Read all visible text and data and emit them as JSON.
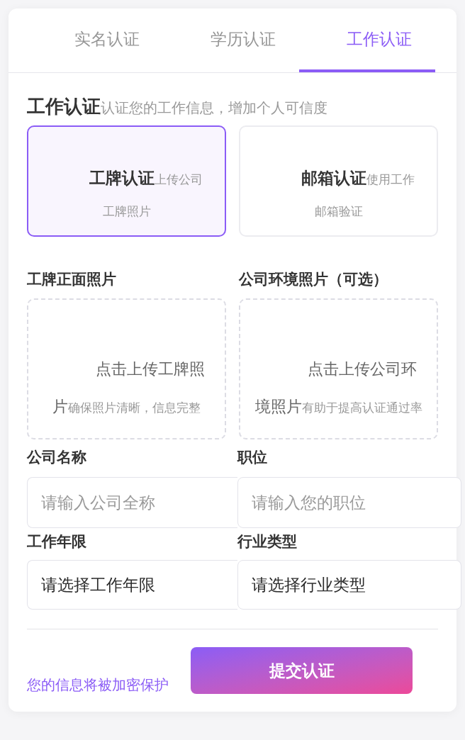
{
  "tabs": [
    {
      "label": "实名认证",
      "selected": false
    },
    {
      "label": "学历认证",
      "selected": false
    },
    {
      "label": "工作认证",
      "selected": true
    }
  ],
  "section": {
    "title": "工作认证",
    "subtitle": "认证您的工作信息，增加个人可信度"
  },
  "methods": [
    {
      "title": "工牌认证",
      "description": "上传公司工牌照片",
      "selected": true
    },
    {
      "title": "邮箱认证",
      "description": "使用工作邮箱验证",
      "selected": false
    }
  ],
  "uploads": [
    {
      "label": "工牌正面照片",
      "prompt": "点击上传工牌照片",
      "hint": "确保照片清晰，信息完整"
    },
    {
      "label": "公司环境照片（可选）",
      "prompt": "点击上传公司环境照片",
      "hint": "有助于提高认证通过率"
    }
  ],
  "fields": [
    {
      "label": "公司名称",
      "kind": "input",
      "placeholder": "请输入公司全称"
    },
    {
      "label": "职位",
      "kind": "input",
      "placeholder": "请输入您的职位"
    },
    {
      "label": "工作年限",
      "kind": "select",
      "value": "请选择工作年限"
    },
    {
      "label": "行业类型",
      "kind": "select",
      "value": "请选择行业类型"
    }
  ],
  "footer": {
    "note": "您的信息将被加密保护",
    "submit": "提交认证"
  }
}
